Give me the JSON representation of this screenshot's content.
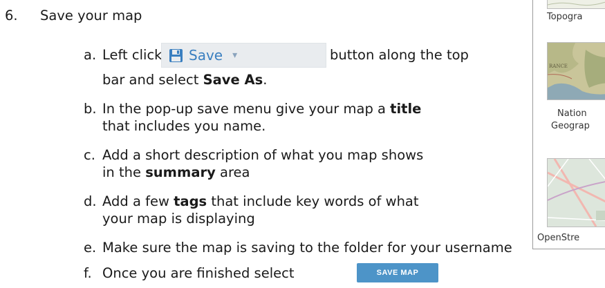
{
  "step": {
    "number": "6.",
    "title": "Save your map"
  },
  "toolbar_button": {
    "icon": "floppy-disk-icon",
    "label": "Save",
    "caret": "▾"
  },
  "items": {
    "a": {
      "marker": "a.",
      "text1": "Left click the",
      "text2": "button along the top",
      "line2_pre": "bar and select ",
      "line2_bold": "Save As",
      "line2_post": "."
    },
    "b": {
      "marker": "b.",
      "line1_pre": "In the pop-up save menu give your map a ",
      "line1_bold": "title",
      "line2": "that includes you name."
    },
    "c": {
      "marker": "c.",
      "line1": "Add a short description of what you map shows",
      "line2_pre": "in the ",
      "line2_bold": "summary",
      "line2_post": " area"
    },
    "d": {
      "marker": "d.",
      "line1_pre": "Add a few ",
      "line1_bold": "tags",
      "line1_post": " that include key words of what",
      "line2": "your map is displaying"
    },
    "e": {
      "marker": "e.",
      "text": "Make sure the map is saving to the folder for your username"
    },
    "f": {
      "marker": "f.",
      "text": "Once you are finished select"
    }
  },
  "save_map_button": {
    "label": "SAVE MAP",
    "color": "#4d94c8"
  },
  "basemap_panel": {
    "captions": [
      "Topogra",
      "Nation",
      "Geograp",
      "OpenStre"
    ]
  }
}
